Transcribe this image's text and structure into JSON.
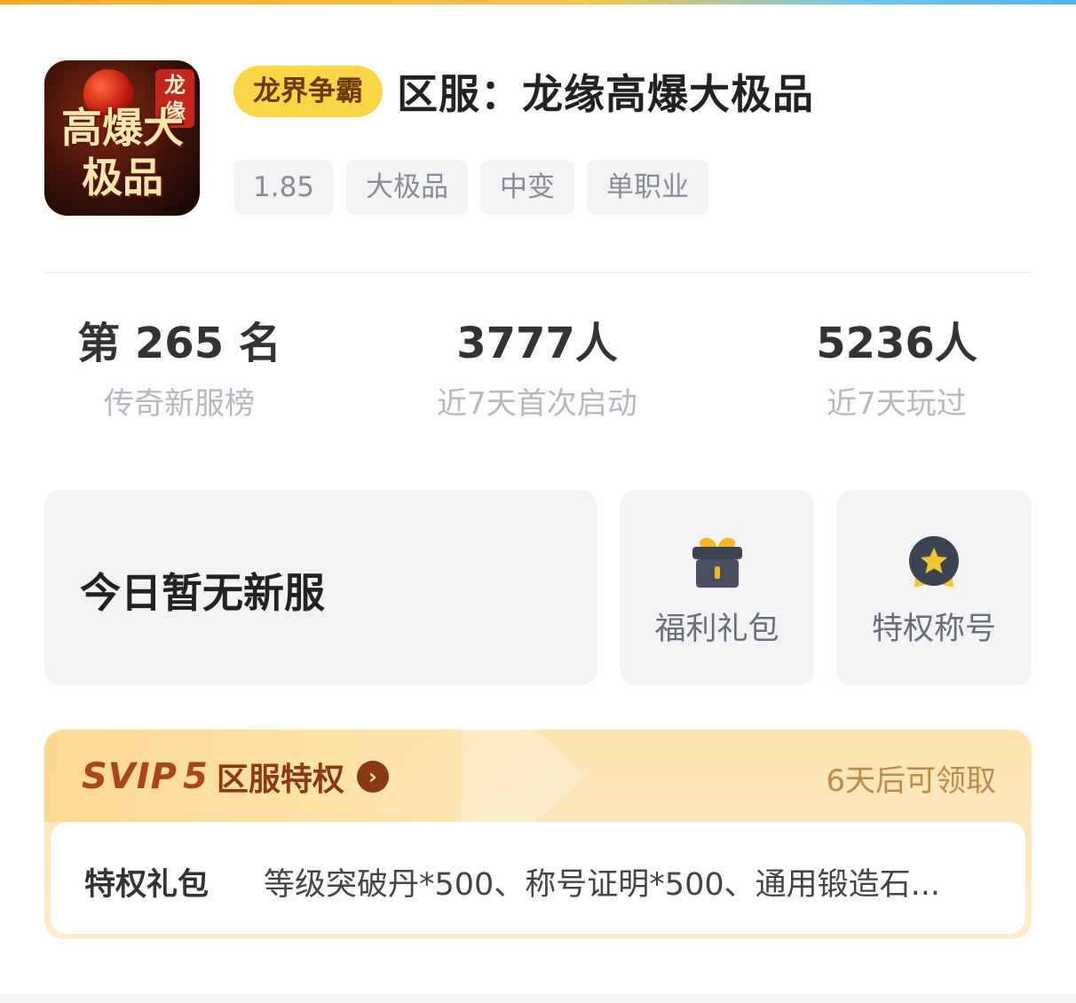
{
  "header": {
    "icon": {
      "name": "game-icon",
      "logo_text": "高爆大极品",
      "logo_seal": "龙缘"
    },
    "brand_chip": "龙界争霸",
    "server_title": "区服：龙缘高爆大极品",
    "tags": [
      "1.85",
      "大极品",
      "中变",
      "单职业"
    ]
  },
  "stats": [
    {
      "value": "第 265 名",
      "label": "传奇新服榜"
    },
    {
      "value": "3777人",
      "label": "近7天首次启动"
    },
    {
      "value": "5236人",
      "label": "近7天玩过"
    }
  ],
  "cards": {
    "main_text": "今日暂无新服",
    "gift": {
      "label": "福利礼包",
      "icon": "gift-box-icon"
    },
    "title": {
      "label": "特权称号",
      "icon": "star-medal-icon"
    }
  },
  "svip": {
    "logo": "SVIP",
    "level": "5",
    "name": "区服特权",
    "arrow_icon": "chevron-right-icon",
    "status": "6天后可领取",
    "body_label": "特权礼包",
    "body_text": "等级突破丹*500、称号证明*500、通用锻造石..."
  },
  "colors": {
    "brand_chip_bg": "#fdd648",
    "svip_accent": "#a8471c",
    "card_bg": "#f2f3f5"
  }
}
